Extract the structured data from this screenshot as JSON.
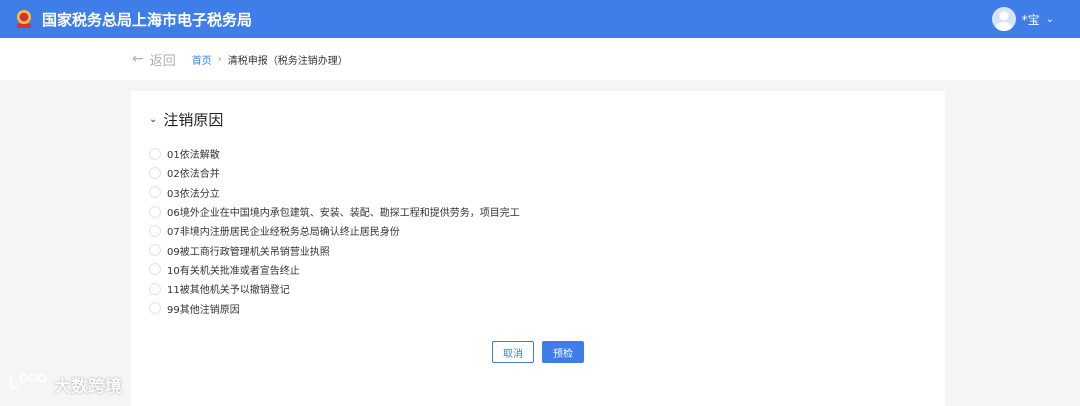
{
  "header": {
    "app_title": "国家税务总局上海市电子税务局",
    "user_name": "*宝",
    "logo_icon": "tax-emblem-icon",
    "accent": "#3f7ee8"
  },
  "nav": {
    "back_label": "返回",
    "breadcrumb": {
      "home": "首页",
      "separator": "›",
      "current": "清税申报（税务注销办理）"
    }
  },
  "section": {
    "title": "注销原因",
    "options": [
      "01依法解散",
      "02依法合并",
      "03依法分立",
      "06境外企业在中国境内承包建筑、安装、装配、勘探工程和提供劳务，项目完工",
      "07非境内注册居民企业经税务总局确认终止居民身份",
      "09被工商行政管理机关吊销营业执照",
      "10有关机关批准或者宣告终止",
      "11被其他机关予以撤销登记",
      "99其他注销原因"
    ]
  },
  "actions": {
    "cancel_label": "取消",
    "precheck_label": "预检"
  },
  "watermark": {
    "text": "大数跨境"
  }
}
